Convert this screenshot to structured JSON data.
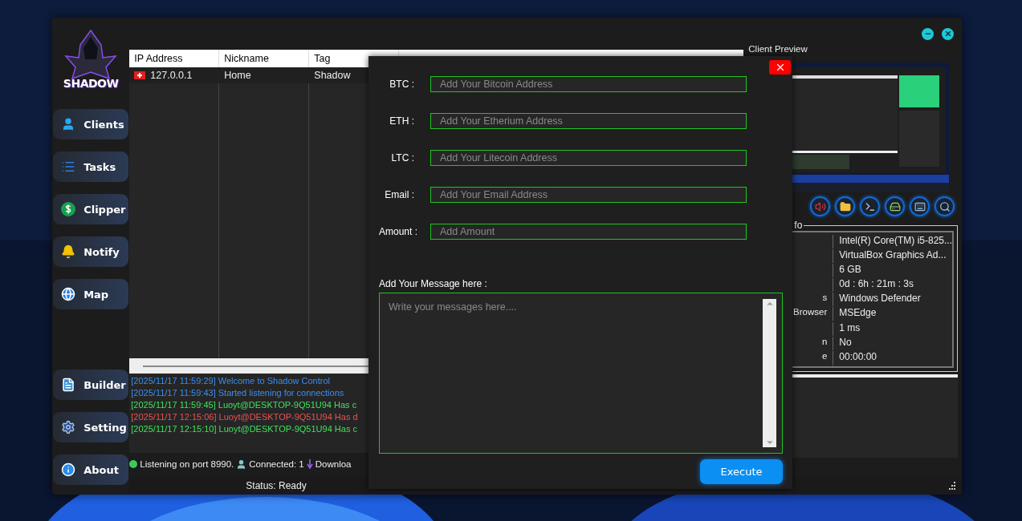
{
  "logo": {
    "text": "SHADOW"
  },
  "sidebar": {
    "top_items": [
      {
        "label": "Clients",
        "kind": "user"
      },
      {
        "label": "Tasks",
        "kind": "list"
      },
      {
        "label": "Clipper",
        "kind": "dollar"
      },
      {
        "label": "Notify",
        "kind": "bell"
      },
      {
        "label": "Map",
        "kind": "globe"
      }
    ],
    "bottom_items": [
      {
        "label": "Builder",
        "kind": "builder"
      },
      {
        "label": "Setting",
        "kind": "gear"
      },
      {
        "label": "About",
        "kind": "info"
      }
    ]
  },
  "table": {
    "columns": [
      "IP Address",
      "Nickname",
      "Tag"
    ],
    "rows": [
      {
        "cells": [
          "127.0.0.1",
          "Home",
          "Shadow"
        ]
      }
    ]
  },
  "log": [
    {
      "text": "[2025/11/17 11:59:29] Welcome to Shadow Control",
      "color": "#3a8ef0"
    },
    {
      "text": "[2025/11/17 11:59:43] Started listening for connections",
      "color": "#3a8ef0"
    },
    {
      "text": "[2025/11/17 11:59:45] Luoyt@DESKTOP-9Q51U94 Has c",
      "color": "#3ee25a"
    },
    {
      "text": "[2025/11/17 12:15:06] Luoyt@DESKTOP-9Q51U94 Has d",
      "color": "#e65454"
    },
    {
      "text": "[2025/11/17 12:15:10] Luoyt@DESKTOP-9Q51U94 Has c",
      "color": "#3ee25a"
    }
  ],
  "status_line": {
    "listening": "Listening on port 8990.",
    "connected": "Connected: 1",
    "download": "Downloa"
  },
  "preview": {
    "title": "Client Preview"
  },
  "info": {
    "title": "fo",
    "rows": [
      {
        "value": "Intel(R) Core(TM) i5-825..."
      },
      {
        "value": "VirtualBox Graphics Ad..."
      },
      {
        "value": "6 GB"
      },
      {
        "value": "0d : 6h : 21m : 3s"
      },
      {
        "label": "s",
        "value": "Windows Defender"
      },
      {
        "label": "Browser",
        "value": "MSEdge"
      },
      {
        "value": "1 ms"
      },
      {
        "label": "n",
        "value": "No"
      },
      {
        "label": "e",
        "value": "00:00:00"
      }
    ]
  },
  "status_bar": {
    "text": "Status: Ready"
  },
  "dialog": {
    "fields": [
      {
        "label": "BTC :",
        "placeholder": "Add Your Bitcoin Address"
      },
      {
        "label": "ETH :",
        "placeholder": "Add Your Etherium Address"
      },
      {
        "label": "LTC :",
        "placeholder": "Add Your Litecoin Address"
      },
      {
        "label": "Email :",
        "placeholder": "Add Your Email Address"
      },
      {
        "label": "Amount :",
        "placeholder": "Add Amount"
      }
    ],
    "message_label": "Add Your Message here :",
    "message_placeholder": "Write your messages here....",
    "button": "Execute"
  }
}
